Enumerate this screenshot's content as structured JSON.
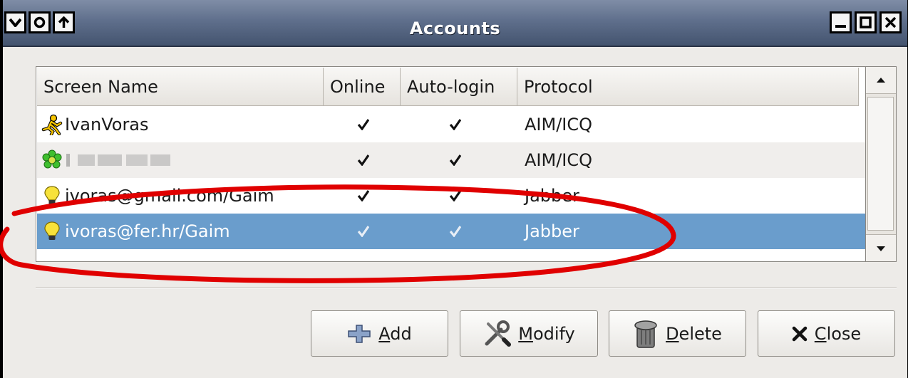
{
  "window": {
    "title": "Accounts",
    "menu_buttons": [
      "menu-down",
      "shade",
      "raise"
    ],
    "controls": [
      "minimize",
      "maximize",
      "close"
    ]
  },
  "accounts": {
    "columns": [
      "Screen Name",
      "Online",
      "Auto-login",
      "Protocol"
    ],
    "rows": [
      {
        "screen_name": "IvanVoras",
        "online": true,
        "auto_login": true,
        "protocol": "AIM/ICQ",
        "icon": "aim-running-man-icon",
        "selected": false
      },
      {
        "screen_name": "",
        "blurred": true,
        "online": true,
        "auto_login": true,
        "protocol": "AIM/ICQ",
        "icon": "icq-flower-icon",
        "selected": false
      },
      {
        "screen_name": "ivoras@gmail.com/Gaim",
        "online": true,
        "auto_login": true,
        "protocol": "Jabber",
        "icon": "jabber-lightbulb-icon",
        "selected": false
      },
      {
        "screen_name": "ivoras@fer.hr/Gaim",
        "online": true,
        "auto_login": true,
        "protocol": "Jabber",
        "icon": "jabber-lightbulb-icon",
        "selected": true
      }
    ]
  },
  "buttons": {
    "add": "Add",
    "modify": "Modify",
    "delete": "Delete",
    "close": "Close"
  },
  "colors": {
    "selection": "#6a9dcc",
    "annotation_ellipse": "#e00000",
    "titlebar": "#5f6f8c"
  }
}
